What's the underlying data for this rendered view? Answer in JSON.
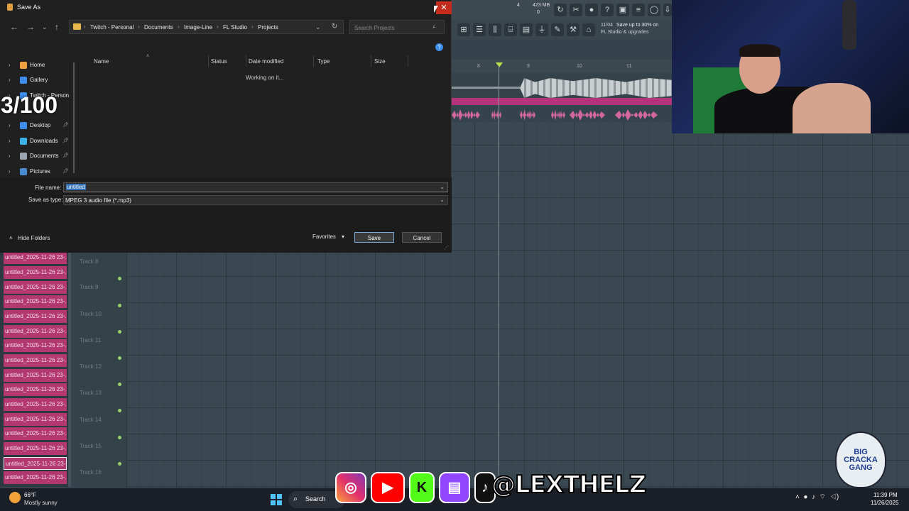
{
  "dialog": {
    "title": "Save As",
    "close_glyph": "✕",
    "breadcrumb": [
      "Twitch - Personal",
      "Documents",
      "Image-Line",
      "FL Studio",
      "Projects"
    ],
    "search_placeholder": "Search Projects",
    "nav_items": [
      {
        "label": "Home",
        "icon": "home-icon",
        "color": "#f0a040",
        "pinned": false
      },
      {
        "label": "Gallery",
        "icon": "gallery-icon",
        "color": "#3b8eea",
        "pinned": false
      },
      {
        "label": "Twitch - Person",
        "icon": "onedrive-icon",
        "color": "#3b8eea",
        "pinned": false
      },
      {
        "label": "Desktop",
        "icon": "desktop-icon",
        "color": "#3b8eea",
        "pinned": true
      },
      {
        "label": "Downloads",
        "icon": "downloads-icon",
        "color": "#3bb0ea",
        "pinned": true
      },
      {
        "label": "Documents",
        "icon": "documents-icon",
        "color": "#9aa4b0",
        "pinned": true
      },
      {
        "label": "Pictures",
        "icon": "pictures-icon",
        "color": "#4a8ad0",
        "pinned": true
      }
    ],
    "columns": [
      "Name",
      "Status",
      "Date modified",
      "Type",
      "Size"
    ],
    "working_text": "Working on it...",
    "file_name_label": "File name:",
    "file_name_value": "untitled",
    "save_type_label": "Save as type:",
    "save_type_value": "MPEG 3 audio file (*.mp3)",
    "hide_folders": "Hide Folders",
    "favorites": "Favorites",
    "save": "Save",
    "cancel": "Cancel"
  },
  "overlay": {
    "counter": "3/100",
    "handle": "@LEXTHELZ",
    "logo_lines": [
      "BIG",
      "CRACKA",
      "GANG"
    ]
  },
  "fl": {
    "memory": "423 MB",
    "beat": "4",
    "zero": "0",
    "promo_date": "11/04",
    "promo_line1": "Save up to 30% on",
    "promo_line2": "FL Studio & upgrades",
    "ruler": [
      "8",
      "9",
      "10",
      "11"
    ],
    "tracks": [
      "Track 8",
      "Track 9",
      "Track 10",
      "Track 11",
      "Track 12",
      "Track 13",
      "Track 14",
      "Track 15",
      "Track 16"
    ],
    "clip_label": "untitled_2025-11-26 23-..."
  },
  "taskbar": {
    "temp": "66°F",
    "condition": "Mostly sunny",
    "search": "Search",
    "time": "11:39 PM",
    "date": "11/26/2025"
  }
}
